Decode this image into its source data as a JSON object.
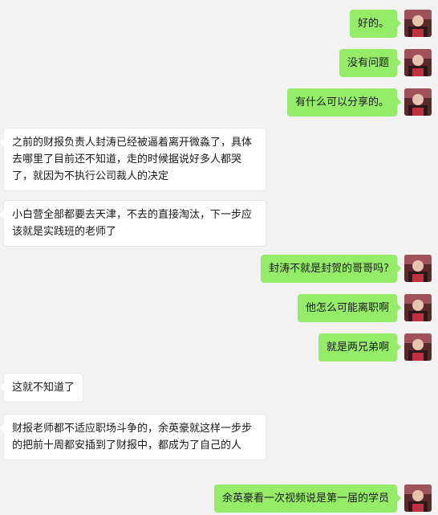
{
  "colors": {
    "background": "#f2f2f2",
    "sent_bubble": "#95ec69",
    "received_bubble": "#ffffff"
  },
  "messages": [
    {
      "side": "right",
      "text": "好的。",
      "avatar": "user-avatar"
    },
    {
      "side": "right",
      "text": "没有问题",
      "avatar": "user-avatar"
    },
    {
      "side": "right",
      "text": "有什么可以分享的。",
      "avatar": "user-avatar"
    },
    {
      "side": "left",
      "text": "之前的财报负责人封涛已经被逼着离开微淼了，具体去哪里了目前还不知道，走的时候据说好多人都哭了，就因为不执行公司裁人的决定"
    },
    {
      "side": "left",
      "text": "小白营全部都要去天津，不去的直接淘汰，下一步应该就是实践班的老师了"
    },
    {
      "side": "right",
      "text": "封涛不就是封贺的哥哥吗?",
      "avatar": "user-avatar"
    },
    {
      "side": "right",
      "text": "他怎么可能离职啊",
      "avatar": "user-avatar"
    },
    {
      "side": "right",
      "text": "就是两兄弟啊",
      "avatar": "user-avatar"
    },
    {
      "side": "left",
      "text": "这就不知道了"
    },
    {
      "side": "left",
      "text": "财报老师都不适应职场斗争的，余英豪就这样一步步的把前十周都安插到了财报中，都成为了自己的人"
    },
    {
      "side": "right",
      "text": "余英豪看一次视频说是第一届的学员",
      "avatar": "user-avatar"
    }
  ]
}
